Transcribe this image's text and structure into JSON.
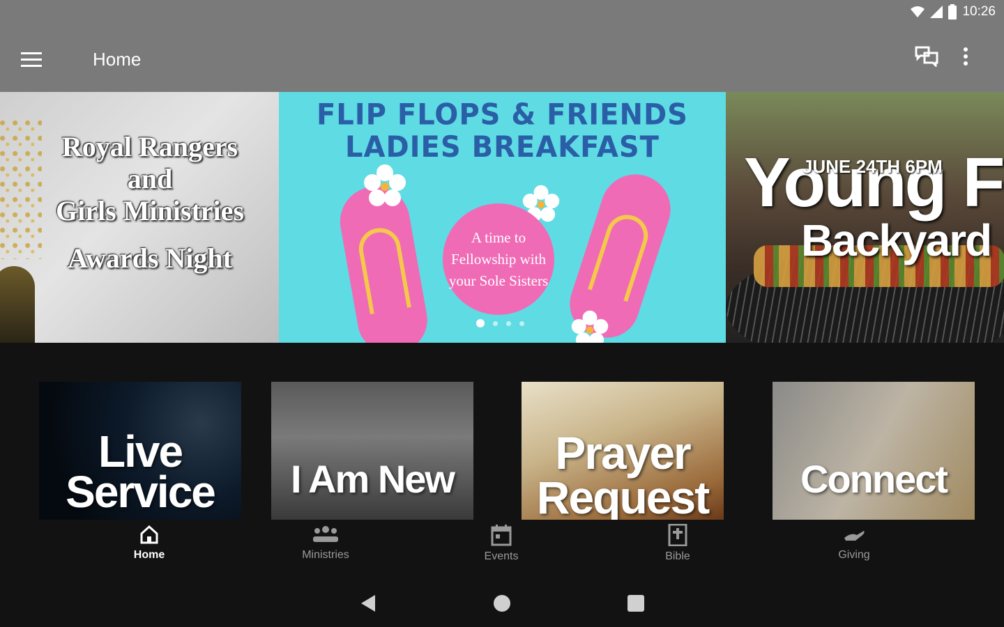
{
  "status_bar": {
    "time": "10:26",
    "icons": [
      "wifi-icon",
      "signal-icon",
      "battery-icon"
    ]
  },
  "app_bar": {
    "title": "Home",
    "icons": [
      "menu-icon",
      "chat-icon",
      "more-vert-icon"
    ]
  },
  "carousel": {
    "slides": [
      {
        "lines": [
          "Royal Rangers",
          "and",
          "Girls Ministries",
          "Awards Night"
        ]
      },
      {
        "title_line1": "FLIP FLOPS & FRIENDS",
        "title_line2": "LADIES BREAKFAST",
        "bubble_text": "A time to Fellowship with your Sole Sisters"
      },
      {
        "date": "JUNE 24TH 6PM",
        "big": "Young Fa",
        "sub": "Backyard"
      }
    ],
    "active_index": 0,
    "dot_count": 4
  },
  "tiles": [
    {
      "label_line1": "Live",
      "label_line2": "Service"
    },
    {
      "label": "I Am New"
    },
    {
      "label_line1": "Prayer",
      "label_line2": "Request"
    },
    {
      "label": "Connect"
    }
  ],
  "bottom_nav": {
    "items": [
      {
        "label": "Home",
        "icon": "home-icon",
        "active": true
      },
      {
        "label": "Ministries",
        "icon": "people-icon",
        "active": false
      },
      {
        "label": "Events",
        "icon": "calendar-icon",
        "active": false
      },
      {
        "label": "Bible",
        "icon": "bible-icon",
        "active": false
      },
      {
        "label": "Giving",
        "icon": "giving-hand-icon",
        "active": false
      }
    ]
  },
  "system_nav": {
    "icons": [
      "back-icon",
      "home-circle-icon",
      "recents-icon"
    ]
  },
  "colors": {
    "bar": "#7a7a7a",
    "background": "#121212",
    "flip_bg": "#5fdbe4",
    "pink": "#f06bb6",
    "flip_title": "#2a5ea6"
  }
}
